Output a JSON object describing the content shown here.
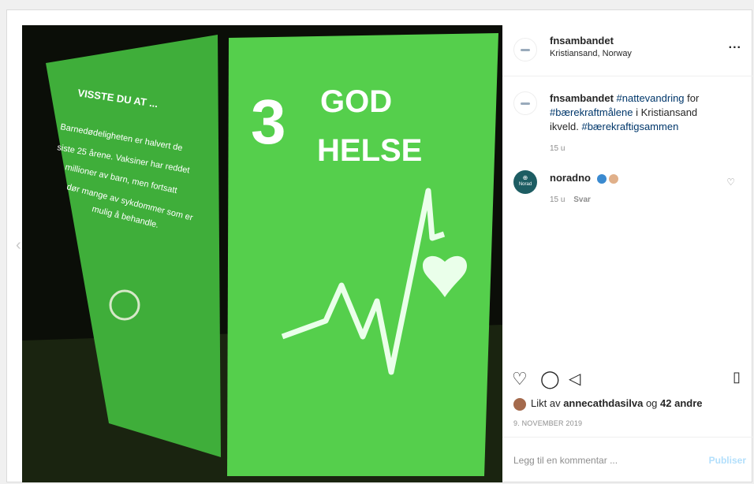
{
  "post_header": {
    "username": "fnsambandet",
    "location": "Kristiansand, Norway",
    "more_label": "..."
  },
  "caption": {
    "username": "fnsambandet",
    "tag1": "#nattevandring",
    "text1": " for",
    "tag2": "#bærekraftmålene",
    "text2": " i Kristiansand ikveld. ",
    "tag3": "#bærekraftigsammen",
    "time": "15 u"
  },
  "comment": {
    "username": "noradno",
    "avatar_text": "Norad",
    "time": "15 u",
    "reply_label": "Svar"
  },
  "likes": {
    "prefix": "Likt av ",
    "user": "annecathdasilva",
    "mid": " og ",
    "others": "42 andre"
  },
  "date": "9. NOVEMBER 2019",
  "comment_input": {
    "placeholder": "Legg til en kommentar ...",
    "publish_label": "Publiser"
  },
  "photo": {
    "left_text_title": "VISSTE DU AT ...",
    "left_text_lines": [
      "Barnedødeligheten er halvert de",
      "siste 25 årene. Vaksiner har reddet",
      "millioner av barn, men fortsatt",
      "dør mange av sykdommer som er",
      "mulig å behandle."
    ],
    "goal_number": "3",
    "goal_line1": "GOD",
    "goal_line2": "HELSE"
  },
  "colors": {
    "cube_green": "#4fc84a",
    "hashtag": "#00376b"
  }
}
